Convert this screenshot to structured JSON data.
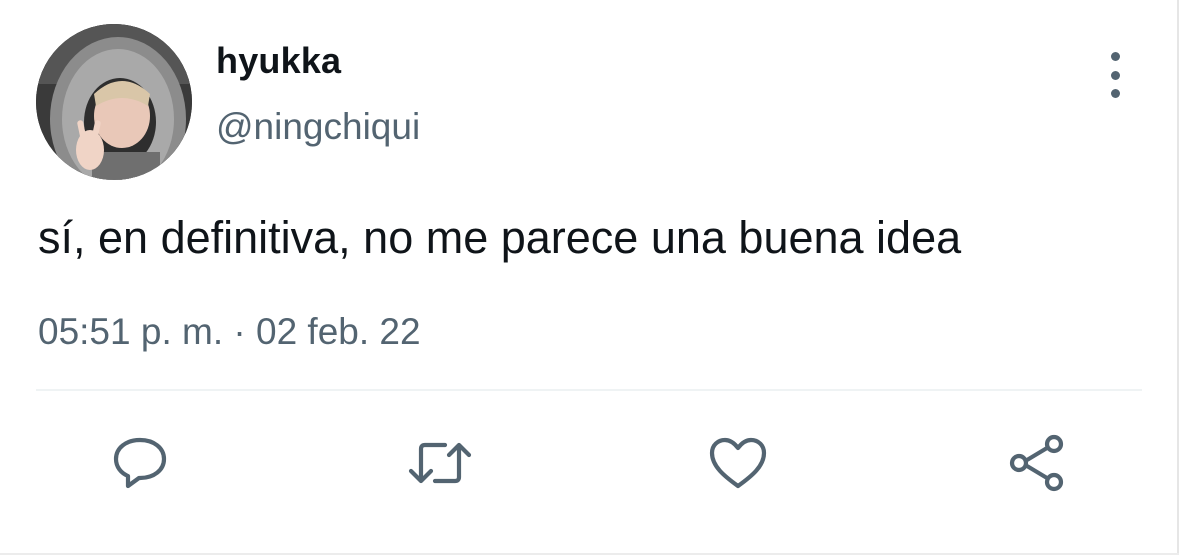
{
  "tweet": {
    "display_name": "hyukka",
    "handle": "@ningchiqui",
    "text": "sí, en definitiva, no me parece una buena idea",
    "time": "05:51 p. m.",
    "separator": " · ",
    "date": "02 feb. 22"
  },
  "icons": {
    "more": "more-vertical-icon",
    "reply": "reply-icon",
    "retweet": "retweet-icon",
    "like": "heart-icon",
    "share": "share-icon"
  },
  "colors": {
    "text_primary": "#0f1419",
    "text_secondary": "#536471",
    "divider": "#eff3f4",
    "background": "#ffffff"
  }
}
